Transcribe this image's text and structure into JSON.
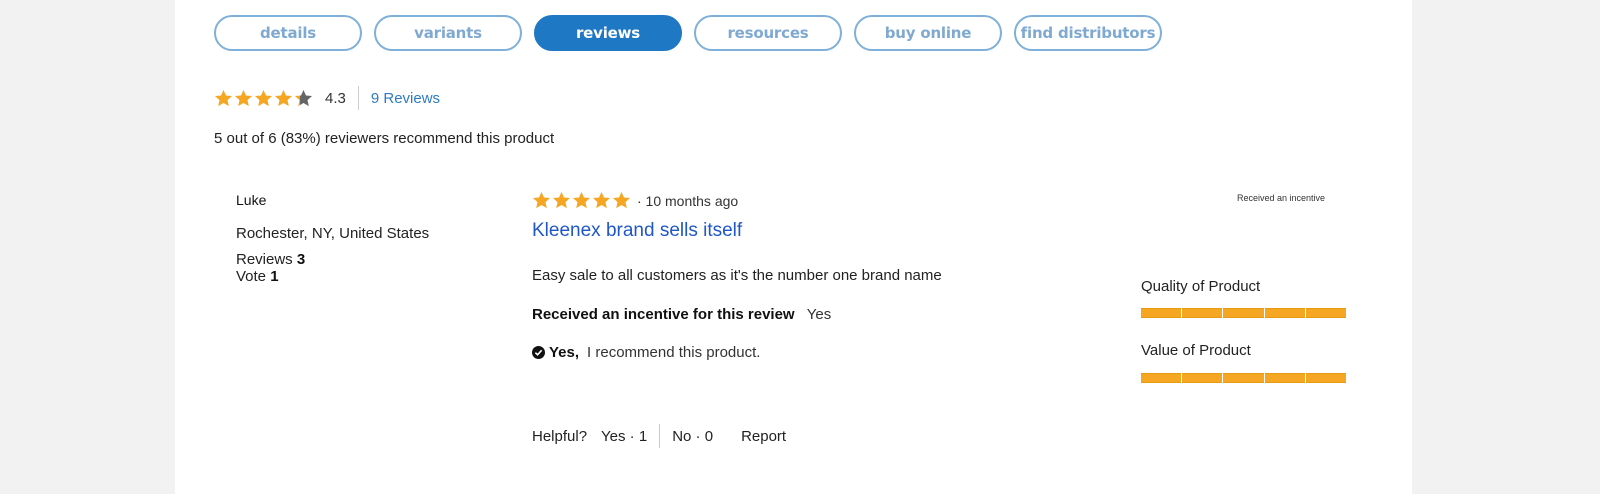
{
  "tabs": [
    {
      "label": "details",
      "active": false
    },
    {
      "label": "variants",
      "active": false
    },
    {
      "label": "reviews",
      "active": true
    },
    {
      "label": "resources",
      "active": false
    },
    {
      "label": "buy online",
      "active": false
    },
    {
      "label": "find distributors",
      "active": false
    }
  ],
  "summary": {
    "average_rating": "4.3",
    "rating_value": 4.3,
    "reviews_link": "9 Reviews",
    "recommend_text": "5 out of 6 (83%) reviewers recommend this product"
  },
  "review": {
    "reviewer_name": "Luke",
    "location": "Rochester, NY, United States",
    "reviews_label": "Reviews",
    "reviews_count": "3",
    "vote_label": "Vote",
    "vote_count": "1",
    "rating_value": 5,
    "time_ago": "· 10 months ago",
    "title": "Kleenex brand sells itself",
    "body": "Easy sale to all customers as it's the number one brand name",
    "incentive_label": "Received an incentive for this review",
    "incentive_value": "Yes",
    "recommend_yes": "Yes,",
    "recommend_text": "I recommend this product.",
    "badge": "Received an incentive",
    "attributes": [
      {
        "label": "Quality of Product",
        "value": 5,
        "max": 5
      },
      {
        "label": "Value of Product",
        "value": 5,
        "max": 5
      }
    ],
    "helpful_label": "Helpful?",
    "helpful_yes": "Yes · 1",
    "helpful_no": "No · 0",
    "report_label": "Report"
  },
  "colors": {
    "accent": "#1f78c4",
    "tab_border": "#7fb0d9",
    "star": "#f5a623",
    "star_empty": "#666666",
    "link": "#2d7cc3",
    "title_link": "#1f57c8"
  }
}
